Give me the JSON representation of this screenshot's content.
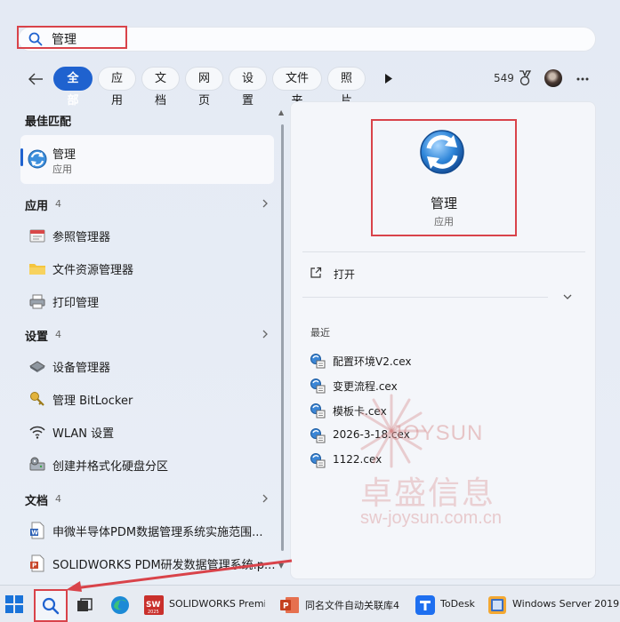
{
  "search": {
    "query": "管理"
  },
  "filters": [
    {
      "label": "全部",
      "active": true
    },
    {
      "label": "应用",
      "active": false
    },
    {
      "label": "文档",
      "active": false
    },
    {
      "label": "网页",
      "active": false
    },
    {
      "label": "设置",
      "active": false
    },
    {
      "label": "文件夹",
      "active": false
    },
    {
      "label": "照片",
      "active": false
    }
  ],
  "rewards": {
    "points": "549"
  },
  "best_match": {
    "title": "最佳匹配",
    "name": "管理",
    "type": "应用"
  },
  "apps": {
    "title": "应用",
    "count": "4",
    "items": [
      {
        "label": "参照管理器",
        "icon": "reference-manager-icon"
      },
      {
        "label": "文件资源管理器",
        "icon": "folder-icon"
      },
      {
        "label": "打印管理",
        "icon": "print-management-icon"
      }
    ]
  },
  "settings": {
    "title": "设置",
    "count": "4",
    "items": [
      {
        "label": "设备管理器",
        "icon": "device-manager-icon"
      },
      {
        "label": "管理 BitLocker",
        "icon": "key-icon"
      },
      {
        "label": "WLAN 设置",
        "icon": "wifi-icon"
      },
      {
        "label": "创建并格式化硬盘分区",
        "icon": "disk-partition-icon"
      }
    ]
  },
  "documents": {
    "title": "文档",
    "count": "4",
    "items": [
      {
        "label": "申微半导体PDM数据管理系统实施范围...",
        "icon": "word-doc-icon"
      },
      {
        "label": "SOLIDWORKS PDM研发数据管理系统.p...",
        "icon": "powerpoint-doc-icon"
      }
    ]
  },
  "preview": {
    "name": "管理",
    "type": "应用",
    "open_label": "打开",
    "recent_title": "最近",
    "recent": [
      {
        "label": "配置环境V2.cex"
      },
      {
        "label": "变更流程.cex"
      },
      {
        "label": "模板卡.cex"
      },
      {
        "label": "2026-3-18.cex"
      },
      {
        "label": "1122.cex"
      }
    ]
  },
  "watermark": {
    "brand": "JOYSUN",
    "chinese": "卓盛信息",
    "url": "sw-joysun.com.cn"
  },
  "taskbar": {
    "apps": [
      {
        "label": "SOLIDWORKS Premiu",
        "icon": "solidworks-icon"
      },
      {
        "label": "同名文件自动关联库4",
        "icon": "powerpoint-icon"
      },
      {
        "label": "ToDesk",
        "icon": "todesk-icon"
      },
      {
        "label": "Windows Server 2019",
        "icon": "vm-icon"
      }
    ]
  },
  "colors": {
    "accent": "#1f62cf",
    "highlight": "#d9434a",
    "watermark": "#d68989"
  }
}
